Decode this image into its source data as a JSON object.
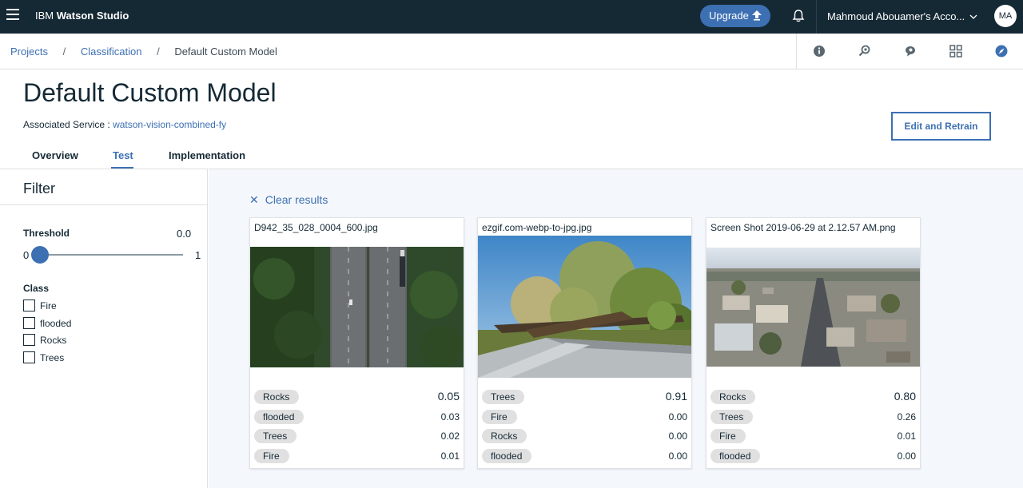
{
  "topbar": {
    "brand_prefix": "IBM",
    "brand_name": "Watson Studio",
    "upgrade_label": "Upgrade",
    "account_name": "Mahmoud Abouamer's Acco...",
    "avatar_initials": "MA"
  },
  "breadcrumb": {
    "items": [
      "Projects",
      "Classification"
    ],
    "current": "Default Custom Model",
    "separator": "/"
  },
  "header": {
    "title": "Default Custom Model",
    "service_label": "Associated Service :",
    "service_link": "watson-vision-combined-fy",
    "edit_button": "Edit and Retrain"
  },
  "tabs": [
    {
      "label": "Overview",
      "active": false
    },
    {
      "label": "Test",
      "active": true
    },
    {
      "label": "Implementation",
      "active": false
    }
  ],
  "filter": {
    "title": "Filter",
    "threshold_label": "Threshold",
    "threshold_value": "0.0",
    "slider_min": "0",
    "slider_max": "1",
    "slider_value": 0.0,
    "class_label": "Class",
    "classes": [
      "Fire",
      "flooded",
      "Rocks",
      "Trees"
    ]
  },
  "results": {
    "clear_label": "Clear results",
    "cards": [
      {
        "filename": "D942_35_028_0004_600.jpg",
        "scores": [
          {
            "label": "Rocks",
            "score": "0.05"
          },
          {
            "label": "flooded",
            "score": "0.03"
          },
          {
            "label": "Trees",
            "score": "0.02"
          },
          {
            "label": "Fire",
            "score": "0.01"
          }
        ]
      },
      {
        "filename": "ezgif.com-webp-to-jpg.jpg",
        "scores": [
          {
            "label": "Trees",
            "score": "0.91"
          },
          {
            "label": "Fire",
            "score": "0.00"
          },
          {
            "label": "Rocks",
            "score": "0.00"
          },
          {
            "label": "flooded",
            "score": "0.00"
          }
        ]
      },
      {
        "filename": "Screen Shot 2019-06-29 at 2.12.57 AM.png",
        "scores": [
          {
            "label": "Rocks",
            "score": "0.80"
          },
          {
            "label": "Trees",
            "score": "0.26"
          },
          {
            "label": "Fire",
            "score": "0.01"
          },
          {
            "label": "flooded",
            "score": "0.00"
          }
        ]
      }
    ]
  },
  "colors": {
    "topbar": "#152935",
    "accent": "#3d70b2",
    "pill": "#e0e0e0",
    "results_bg": "#f4f7fb"
  },
  "icons": [
    "menu-icon",
    "upload-arrow-icon",
    "bell-icon",
    "chevron-down-icon",
    "info-icon",
    "find-icon",
    "chat-icon",
    "grid-icon",
    "compass-icon",
    "close-icon"
  ]
}
